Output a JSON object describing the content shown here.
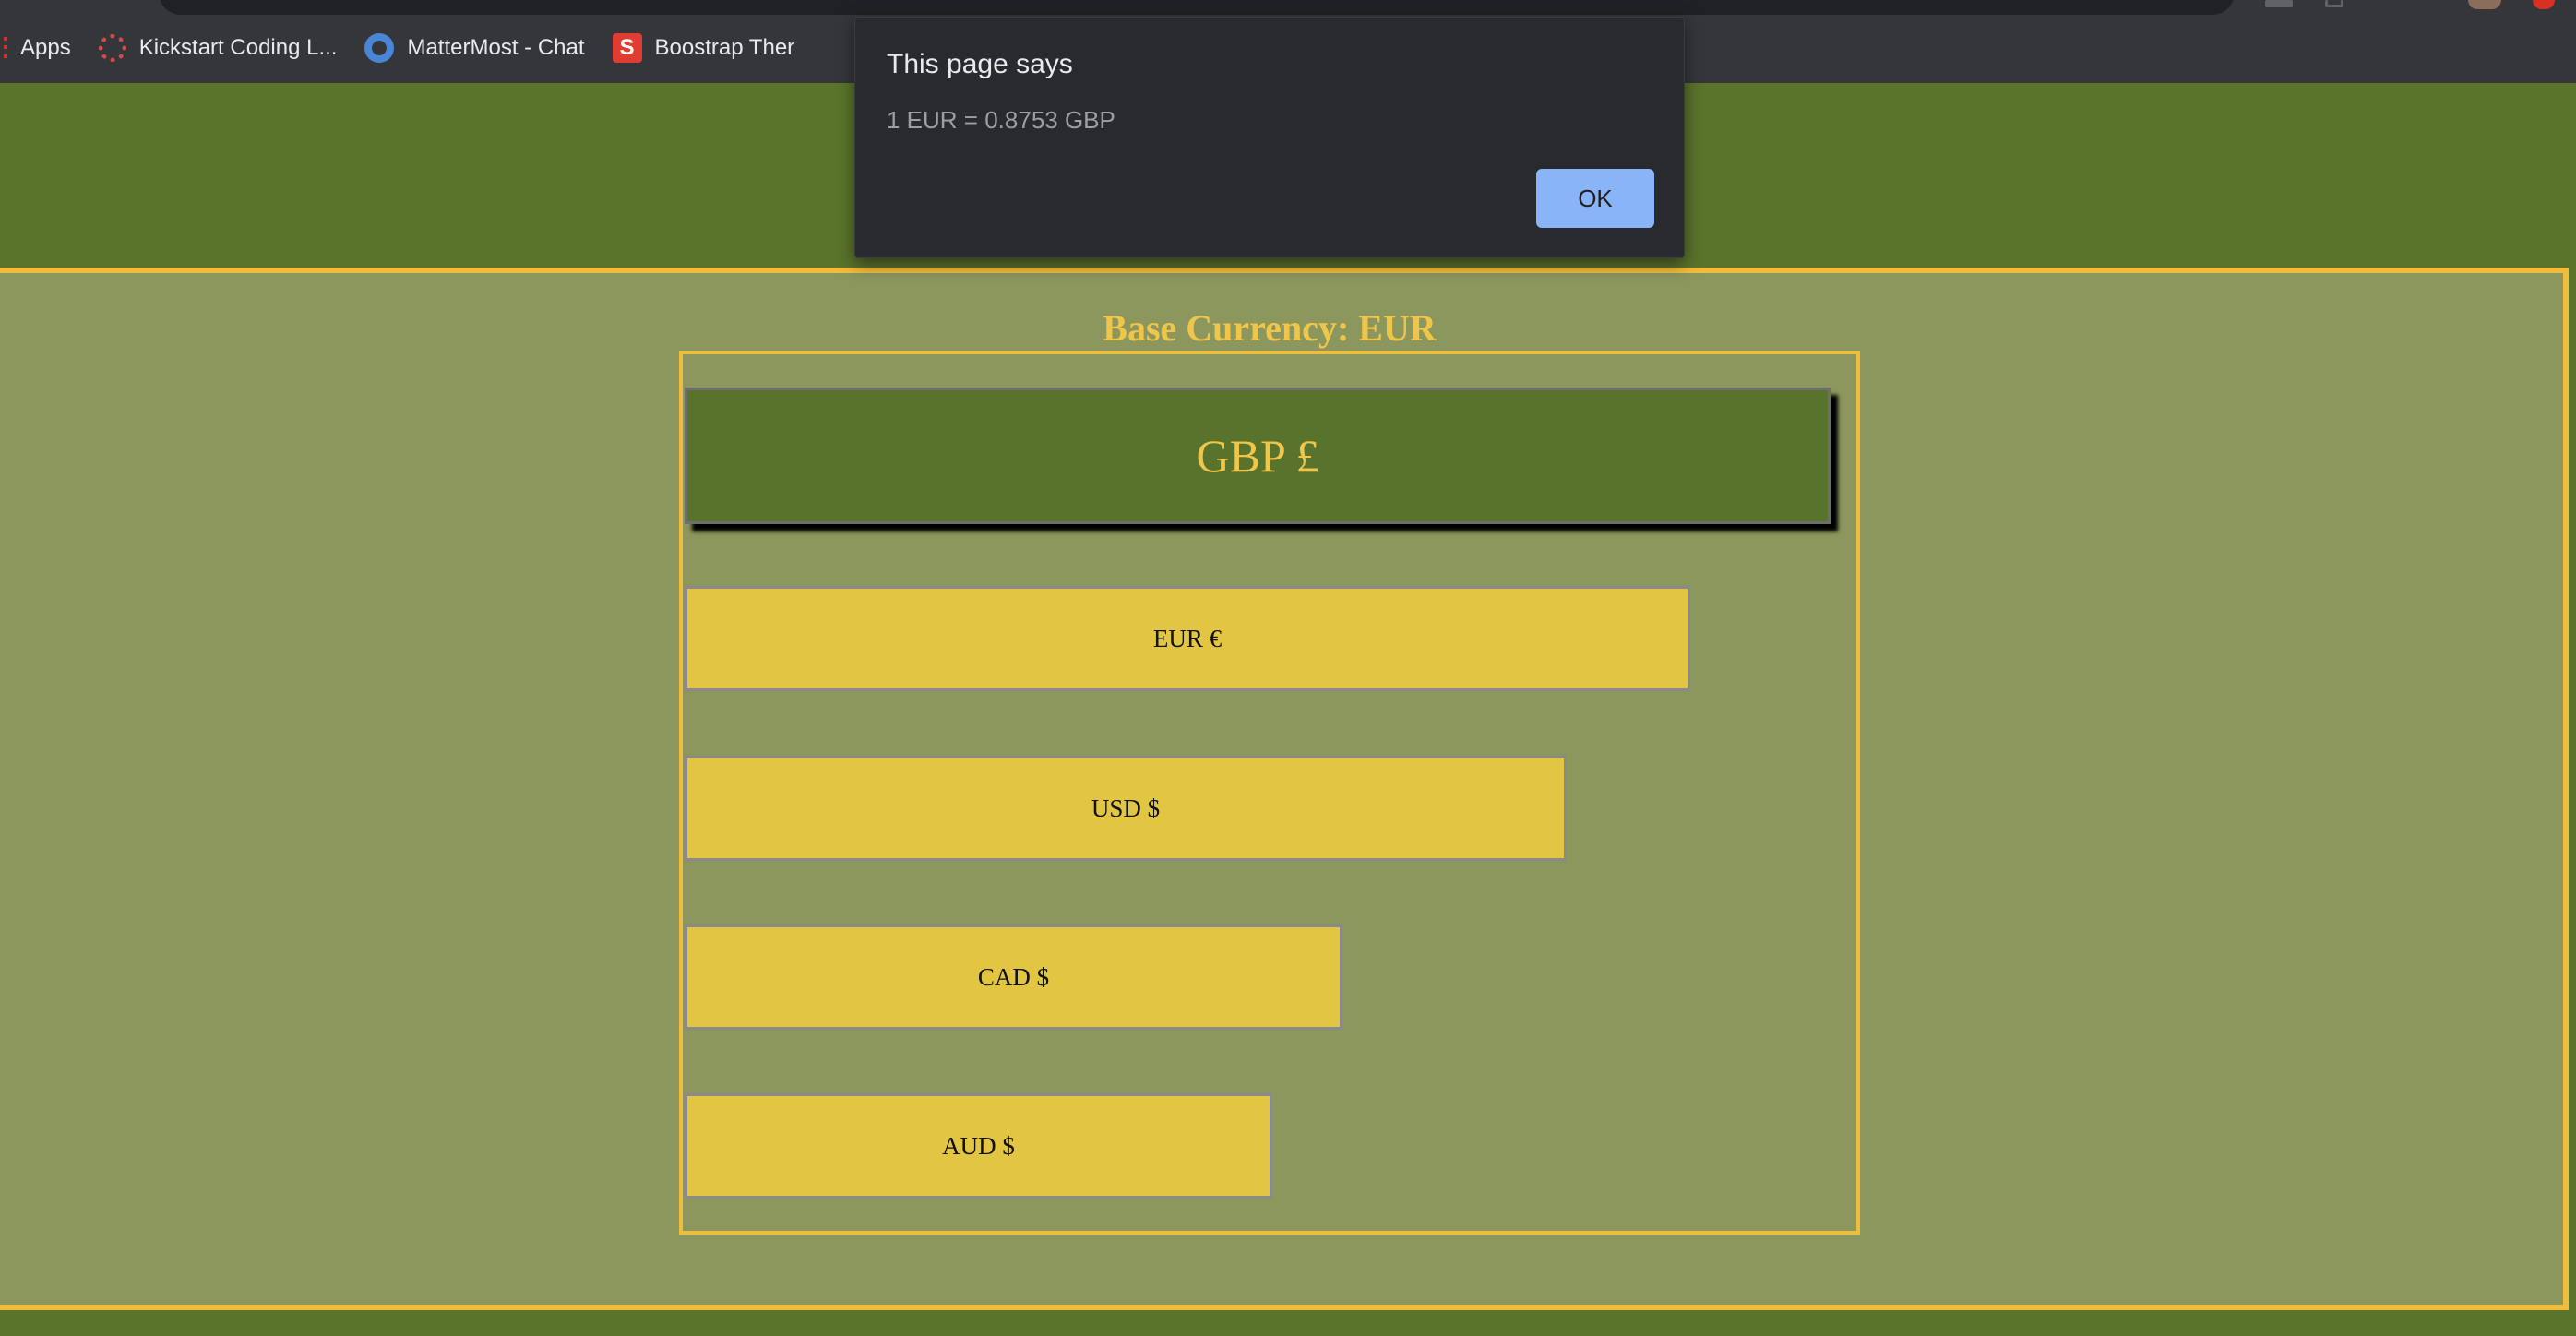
{
  "bookmarks": [
    {
      "label": "Apps",
      "icon": "apps-grid-icon"
    },
    {
      "label": "Kickstart Coding L...",
      "icon": "kickstart-icon"
    },
    {
      "label": "MatterMost - Chat",
      "icon": "mattermost-icon"
    },
    {
      "label": "Boostrap Ther",
      "icon": "bootstrap-icon",
      "icon_glyph": "S"
    }
  ],
  "dialog": {
    "title": "This page says",
    "message": "1 EUR = 0.8753 GBP",
    "ok_label": "OK"
  },
  "page": {
    "base_currency_label": "Base Currency: EUR",
    "target_currency": "GBP £",
    "rates": [
      {
        "label": "EUR €",
        "relative_width": 1.0
      },
      {
        "label": "USD $",
        "relative_width": 0.877
      },
      {
        "label": "CAD $",
        "relative_width": 0.654
      },
      {
        "label": "AUD $",
        "relative_width": 0.584
      }
    ]
  },
  "colors": {
    "header_green": "#5a742b",
    "panel_olive": "#8b975c",
    "accent_gold": "#f0bc3c",
    "bar_yellow": "#e2c643",
    "dialog_button_blue": "#8ab4f8"
  }
}
